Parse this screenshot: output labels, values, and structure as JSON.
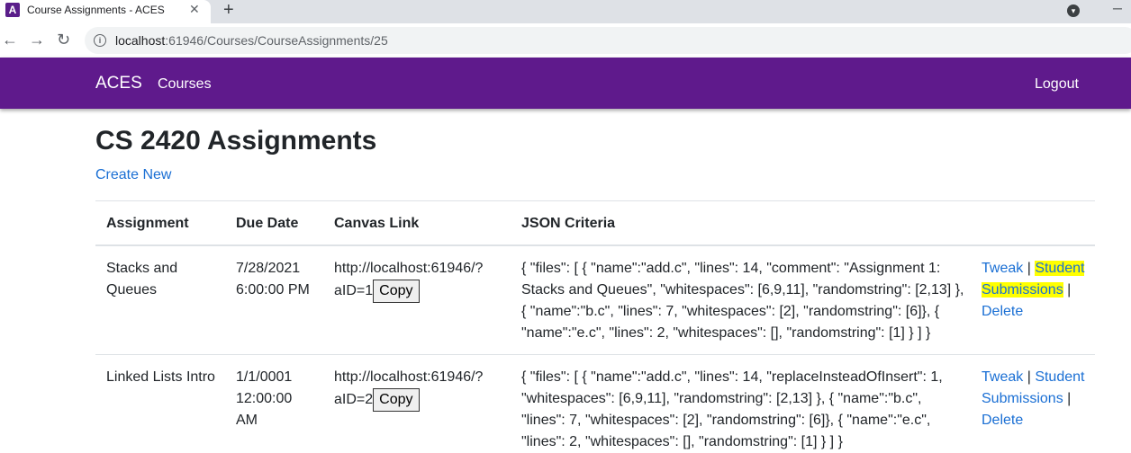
{
  "browser": {
    "tab_title": "Course Assignments - ACES",
    "favicon_letter": "A",
    "url_host": "localhost",
    "url_rest": ":61946/Courses/CourseAssignments/25"
  },
  "nav": {
    "brand": "ACES",
    "courses": "Courses",
    "logout": "Logout"
  },
  "page": {
    "title": "CS 2420 Assignments",
    "create_new": "Create New"
  },
  "table": {
    "headers": [
      "Assignment",
      "Due Date",
      "Canvas Link",
      "JSON Criteria"
    ],
    "rows": [
      {
        "assignment": [
          "Stacks and",
          "Queues"
        ],
        "due": [
          "7/28/2021",
          "6:00:00 PM"
        ],
        "link_line1": "http://localhost:61946/?",
        "link_line2": "aID=1",
        "copy": "Copy",
        "json": [
          "{ \"files\": [ { \"name\":\"add.c\", \"lines\": 14, \"comment\": \"Assignment 1:",
          "Stacks and Queues\", \"whitespaces\": [6,9,11], \"randomstring\": [2,13] },",
          "{ \"name\":\"b.c\", \"lines\": 7, \"whitespaces\": [2], \"randomstring\": [6]}, {",
          "\"name\":\"e.c\", \"lines\": 2, \"whitespaces\": [], \"randomstring\": [1] } ] }"
        ],
        "tweak": "Tweak",
        "sep": "|",
        "student_a": "Student",
        "student_b": "Submissions",
        "sep2": "|",
        "delete": "Delete"
      },
      {
        "assignment": [
          "Linked Lists Intro"
        ],
        "due": [
          "1/1/0001",
          "12:00:00",
          "AM"
        ],
        "link_line1": "http://localhost:61946/?",
        "link_line2": "aID=2",
        "copy": "Copy",
        "json": [
          "{ \"files\": [ { \"name\":\"add.c\", \"lines\": 14, \"replaceInsteadOfInsert\": 1,",
          "\"whitespaces\": [6,9,11], \"randomstring\": [2,13] }, { \"name\":\"b.c\",",
          "\"lines\": 7, \"whitespaces\": [2], \"randomstring\": [6]}, { \"name\":\"e.c\",",
          "\"lines\": 2, \"whitespaces\": [], \"randomstring\": [1] } ] }"
        ],
        "tweak": "Tweak",
        "sep": "|",
        "student_a": "Student",
        "student_b": "Submissions",
        "sep2": "|",
        "delete": "Delete"
      }
    ]
  }
}
